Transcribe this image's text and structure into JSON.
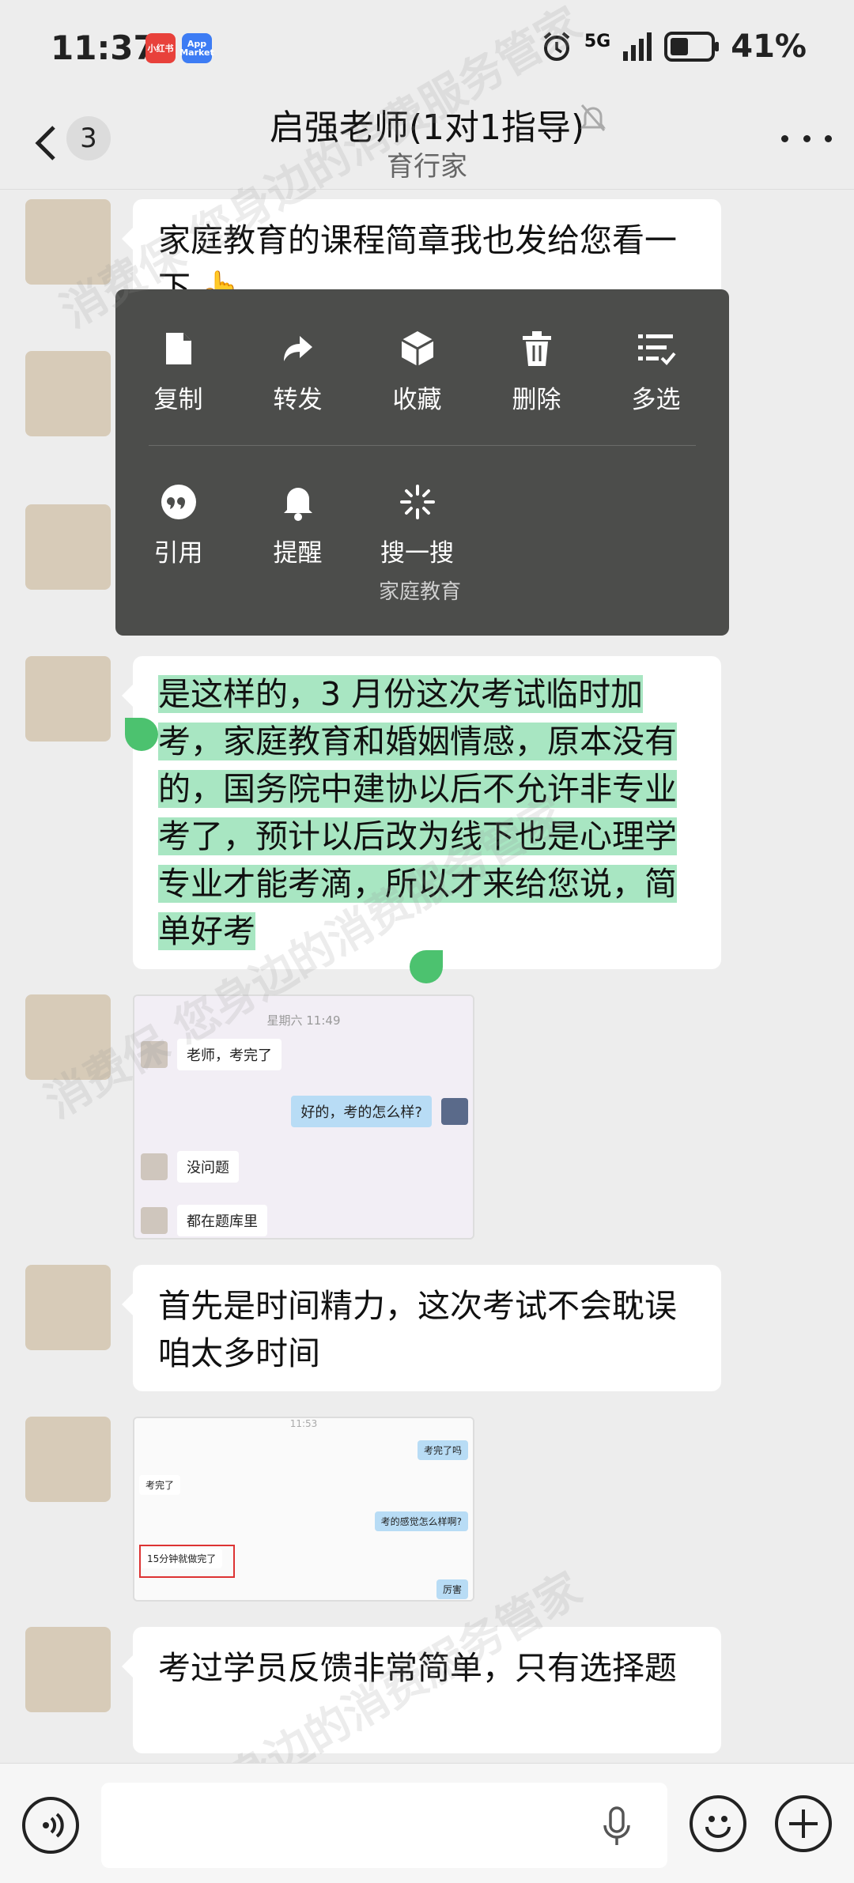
{
  "status_bar": {
    "time": "11:37",
    "app_badges": [
      "小红书",
      "App Market"
    ],
    "network": "5G",
    "battery": "41%"
  },
  "nav": {
    "unread_count": "3",
    "title": "启强老师(1对1指导)",
    "subtitle": "育行家"
  },
  "messages": [
    {
      "type": "text",
      "text": "家庭教育的课程简章我也发给您看一下 👆"
    },
    {
      "type": "text",
      "text": "是这样的，3 月份这次考试临时加考，家庭教育和婚姻情感，原本没有的，国务院中建协以后不允许非专业考了，预计以后改为线下也是心理学专业才能考滴，所以才来给您说，简单好考"
    },
    {
      "type": "image",
      "screenshot": {
        "timestamp": "星期六 11:49",
        "rows": [
          "老师，考完了",
          "好的，考的怎么样?",
          "没问题",
          "都在题库里"
        ]
      }
    },
    {
      "type": "text",
      "text": "首先是时间精力，这次考试不会耽误咱太多时间"
    },
    {
      "type": "image",
      "screenshot": {
        "timestamp": "11:53",
        "rows": [
          "考完了吗",
          "考完了",
          "考的感觉怎么样啊?",
          "15分钟就做完了",
          "厉害"
        ]
      }
    },
    {
      "type": "text",
      "text": "考过学员反馈非常简单，只有选择题"
    }
  ],
  "context_menu": {
    "row1": [
      {
        "label": "复制",
        "icon": "document-icon"
      },
      {
        "label": "转发",
        "icon": "forward-icon"
      },
      {
        "label": "收藏",
        "icon": "cube-icon"
      },
      {
        "label": "删除",
        "icon": "trash-icon"
      },
      {
        "label": "多选",
        "icon": "multi-select-icon"
      }
    ],
    "row2": [
      {
        "label": "引用",
        "icon": "quote-icon"
      },
      {
        "label": "提醒",
        "icon": "bell-icon"
      },
      {
        "label": "搜一搜",
        "icon": "search-sparkle-icon"
      }
    ],
    "search_hint": "家庭教育"
  },
  "watermark": "消费保 您身边的消费服务管家",
  "colors": {
    "background": "#ededed",
    "bubble": "#ffffff",
    "selection": "#a8e6c2",
    "selection_handle": "#4cc26f",
    "menu": "#4c4d4b"
  }
}
